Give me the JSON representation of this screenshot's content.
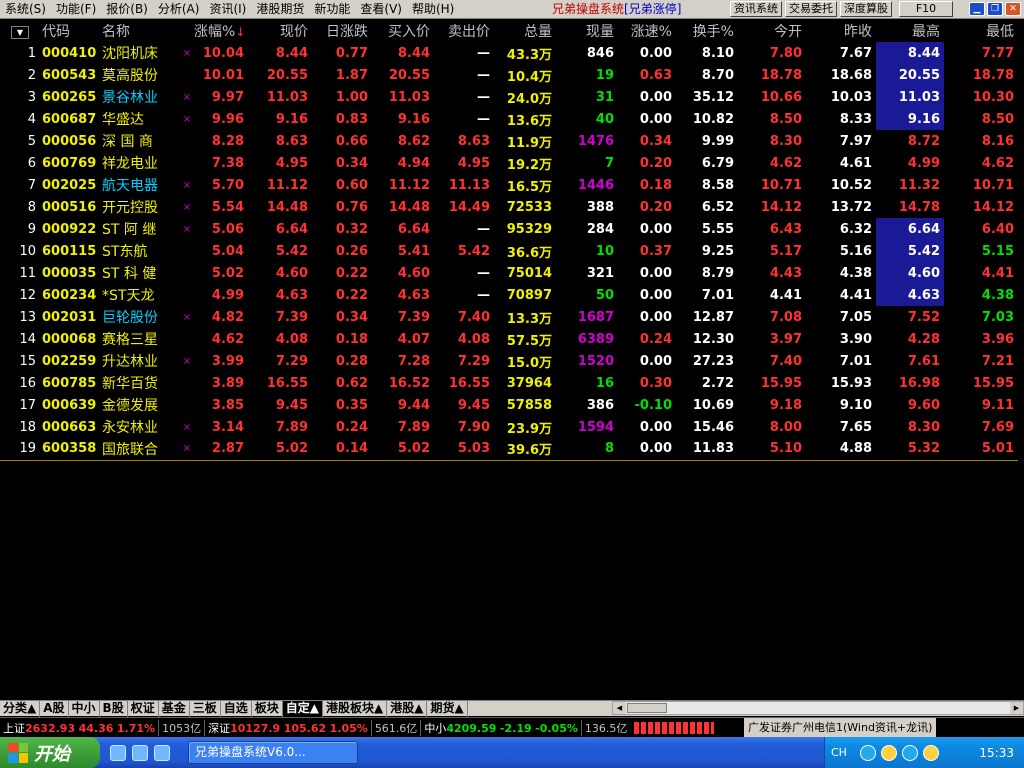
{
  "menu": [
    "系统(S)",
    "功能(F)",
    "报价(B)",
    "分析(A)",
    "资讯(I)",
    "港股期货",
    "新功能",
    "查看(V)",
    "帮助(H)"
  ],
  "app_title": {
    "main": "兄弟操盘系统",
    "tag": "[兄弟涨停]"
  },
  "top_buttons": [
    "资讯系统",
    "交易委托",
    "深度算股"
  ],
  "f10_label": "F10",
  "columns": {
    "code": "代码",
    "name": "名称",
    "change_pct": "涨幅%",
    "price": "现价",
    "change": "日涨跌",
    "bid": "买入价",
    "ask": "卖出价",
    "volume": "总量",
    "cur_vol": "现量",
    "speed": "涨速%",
    "turnover": "换手%",
    "open": "今开",
    "prev_close": "昨收",
    "high": "最高",
    "low": "最低"
  },
  "sort_indicator": "↓",
  "rows": [
    {
      "idx": "1",
      "code": "000410",
      "name": "沈阳机床",
      "mark": "×",
      "change_pct": "10.04",
      "price": "8.44",
      "change": "0.77",
      "bid": "8.44",
      "ask": "—",
      "volume": "43.3万",
      "cur_vol": "846",
      "speed": "0.00",
      "turnover": "8.10",
      "open": "7.80",
      "prev_close": "7.67",
      "high": "8.44",
      "low": "7.77"
    },
    {
      "idx": "2",
      "code": "600543",
      "name": "莫高股份",
      "mark": "",
      "change_pct": "10.01",
      "price": "20.55",
      "change": "1.87",
      "bid": "20.55",
      "ask": "—",
      "volume": "10.4万",
      "cur_vol": "19",
      "speed": "0.63",
      "turnover": "8.70",
      "open": "18.78",
      "prev_close": "18.68",
      "high": "20.55",
      "low": "18.78"
    },
    {
      "idx": "3",
      "code": "600265",
      "name": "景谷林业",
      "mark": "×",
      "change_pct": "9.97",
      "price": "11.03",
      "change": "1.00",
      "bid": "11.03",
      "ask": "—",
      "volume": "24.0万",
      "cur_vol": "31",
      "speed": "0.00",
      "turnover": "35.12",
      "open": "10.66",
      "prev_close": "10.03",
      "high": "11.03",
      "low": "10.30"
    },
    {
      "idx": "4",
      "code": "600687",
      "name": "华盛达",
      "mark": "×",
      "change_pct": "9.96",
      "price": "9.16",
      "change": "0.83",
      "bid": "9.16",
      "ask": "—",
      "volume": "13.6万",
      "cur_vol": "40",
      "speed": "0.00",
      "turnover": "10.82",
      "open": "8.50",
      "prev_close": "8.33",
      "high": "9.16",
      "low": "8.50"
    },
    {
      "idx": "5",
      "code": "000056",
      "name": "深 国 商",
      "mark": "",
      "change_pct": "8.28",
      "price": "8.63",
      "change": "0.66",
      "bid": "8.62",
      "ask": "8.63",
      "volume": "11.9万",
      "cur_vol": "1476",
      "speed": "0.34",
      "turnover": "9.99",
      "open": "8.30",
      "prev_close": "7.97",
      "high": "8.72",
      "low": "8.16"
    },
    {
      "idx": "6",
      "code": "600769",
      "name": "祥龙电业",
      "mark": "",
      "change_pct": "7.38",
      "price": "4.95",
      "change": "0.34",
      "bid": "4.94",
      "ask": "4.95",
      "volume": "19.2万",
      "cur_vol": "7",
      "speed": "0.20",
      "turnover": "6.79",
      "open": "4.62",
      "prev_close": "4.61",
      "high": "4.99",
      "low": "4.62"
    },
    {
      "idx": "7",
      "code": "002025",
      "name": "航天电器",
      "mark": "×",
      "change_pct": "5.70",
      "price": "11.12",
      "change": "0.60",
      "bid": "11.12",
      "ask": "11.13",
      "volume": "16.5万",
      "cur_vol": "1446",
      "speed": "0.18",
      "turnover": "8.58",
      "open": "10.71",
      "prev_close": "10.52",
      "high": "11.32",
      "low": "10.71"
    },
    {
      "idx": "8",
      "code": "000516",
      "name": "开元控股",
      "mark": "×",
      "change_pct": "5.54",
      "price": "14.48",
      "change": "0.76",
      "bid": "14.48",
      "ask": "14.49",
      "volume": "72533",
      "cur_vol": "388",
      "speed": "0.20",
      "turnover": "6.52",
      "open": "14.12",
      "prev_close": "13.72",
      "high": "14.78",
      "low": "14.12"
    },
    {
      "idx": "9",
      "code": "000922",
      "name": "ST 阿 继",
      "mark": "×",
      "change_pct": "5.06",
      "price": "6.64",
      "change": "0.32",
      "bid": "6.64",
      "ask": "—",
      "volume": "95329",
      "cur_vol": "284",
      "speed": "0.00",
      "turnover": "5.55",
      "open": "6.43",
      "prev_close": "6.32",
      "high": "6.64",
      "low": "6.40"
    },
    {
      "idx": "10",
      "code": "600115",
      "name": "ST东航",
      "mark": "",
      "change_pct": "5.04",
      "price": "5.42",
      "change": "0.26",
      "bid": "5.41",
      "ask": "5.42",
      "volume": "36.6万",
      "cur_vol": "10",
      "speed": "0.37",
      "turnover": "9.25",
      "open": "5.17",
      "prev_close": "5.16",
      "high": "5.42",
      "low": "5.15"
    },
    {
      "idx": "11",
      "code": "000035",
      "name": "ST 科 健",
      "mark": "",
      "change_pct": "5.02",
      "price": "4.60",
      "change": "0.22",
      "bid": "4.60",
      "ask": "—",
      "volume": "75014",
      "cur_vol": "321",
      "speed": "0.00",
      "turnover": "8.79",
      "open": "4.43",
      "prev_close": "4.38",
      "high": "4.60",
      "low": "4.41"
    },
    {
      "idx": "12",
      "code": "600234",
      "name": "*ST天龙",
      "mark": "",
      "change_pct": "4.99",
      "price": "4.63",
      "change": "0.22",
      "bid": "4.63",
      "ask": "—",
      "volume": "70897",
      "cur_vol": "50",
      "speed": "0.00",
      "turnover": "7.01",
      "open": "4.41",
      "prev_close": "4.41",
      "high": "4.63",
      "low": "4.38"
    },
    {
      "idx": "13",
      "code": "002031",
      "name": "巨轮股份",
      "mark": "×",
      "change_pct": "4.82",
      "price": "7.39",
      "change": "0.34",
      "bid": "7.39",
      "ask": "7.40",
      "volume": "13.3万",
      "cur_vol": "1687",
      "speed": "0.00",
      "turnover": "12.87",
      "open": "7.08",
      "prev_close": "7.05",
      "high": "7.52",
      "low": "7.03"
    },
    {
      "idx": "14",
      "code": "000068",
      "name": "赛格三星",
      "mark": "",
      "change_pct": "4.62",
      "price": "4.08",
      "change": "0.18",
      "bid": "4.07",
      "ask": "4.08",
      "volume": "57.5万",
      "cur_vol": "6389",
      "speed": "0.24",
      "turnover": "12.30",
      "open": "3.97",
      "prev_close": "3.90",
      "high": "4.28",
      "low": "3.96"
    },
    {
      "idx": "15",
      "code": "002259",
      "name": "升达林业",
      "mark": "×",
      "change_pct": "3.99",
      "price": "7.29",
      "change": "0.28",
      "bid": "7.28",
      "ask": "7.29",
      "volume": "15.0万",
      "cur_vol": "1520",
      "speed": "0.00",
      "turnover": "27.23",
      "open": "7.40",
      "prev_close": "7.01",
      "high": "7.61",
      "low": "7.21"
    },
    {
      "idx": "16",
      "code": "600785",
      "name": "新华百货",
      "mark": "",
      "change_pct": "3.89",
      "price": "16.55",
      "change": "0.62",
      "bid": "16.52",
      "ask": "16.55",
      "volume": "37964",
      "cur_vol": "16",
      "speed": "0.30",
      "turnover": "2.72",
      "open": "15.95",
      "prev_close": "15.93",
      "high": "16.98",
      "low": "15.95"
    },
    {
      "idx": "17",
      "code": "000639",
      "name": "金德发展",
      "mark": "",
      "change_pct": "3.85",
      "price": "9.45",
      "change": "0.35",
      "bid": "9.44",
      "ask": "9.45",
      "volume": "57858",
      "cur_vol": "386",
      "speed": "-0.10",
      "turnover": "10.69",
      "open": "9.18",
      "prev_close": "9.10",
      "high": "9.60",
      "low": "9.11"
    },
    {
      "idx": "18",
      "code": "000663",
      "name": "永安林业",
      "mark": "×",
      "change_pct": "3.14",
      "price": "7.89",
      "change": "0.24",
      "bid": "7.89",
      "ask": "7.90",
      "volume": "23.9万",
      "cur_vol": "1594",
      "speed": "0.00",
      "turnover": "15.46",
      "open": "8.00",
      "prev_close": "7.65",
      "high": "8.30",
      "low": "7.69"
    },
    {
      "idx": "19",
      "code": "600358",
      "name": "国旅联合",
      "mark": "×",
      "change_pct": "2.87",
      "price": "5.02",
      "change": "0.14",
      "bid": "5.02",
      "ask": "5.03",
      "volume": "39.6万",
      "cur_vol": "8",
      "speed": "0.00",
      "turnover": "11.83",
      "open": "5.10",
      "prev_close": "4.88",
      "high": "5.32",
      "low": "5.01"
    }
  ],
  "tabs": [
    "分类▲",
    "A股",
    "中小",
    "B股",
    "权证",
    "基金",
    "三板",
    "自选",
    "板块",
    "自定▲",
    "港股板块▲",
    "港股▲",
    "期货▲"
  ],
  "active_tab": "自定▲",
  "status": {
    "sh_label": "上证",
    "sh_index": "2632.93",
    "sh_change": "44.36",
    "sh_pct": "1.71%",
    "sh_amount": "1053亿",
    "sz_label": "深证",
    "sz_index": "10127.9",
    "sz_change": "105.62",
    "sz_pct": "1.05%",
    "sz_amount": "561.6亿",
    "zx_label": "中小",
    "zx_index": "4209.59",
    "zx_change": "-2.19",
    "zx_pct": "-0.05%",
    "zx_amount": "136.5亿",
    "broker": "广发证券广州电信1(Wind资讯+龙讯)"
  },
  "taskbar": {
    "start": "开始",
    "task": "兄弟操盘系统V6.0...",
    "lang": "CH",
    "clock": "15:33"
  }
}
